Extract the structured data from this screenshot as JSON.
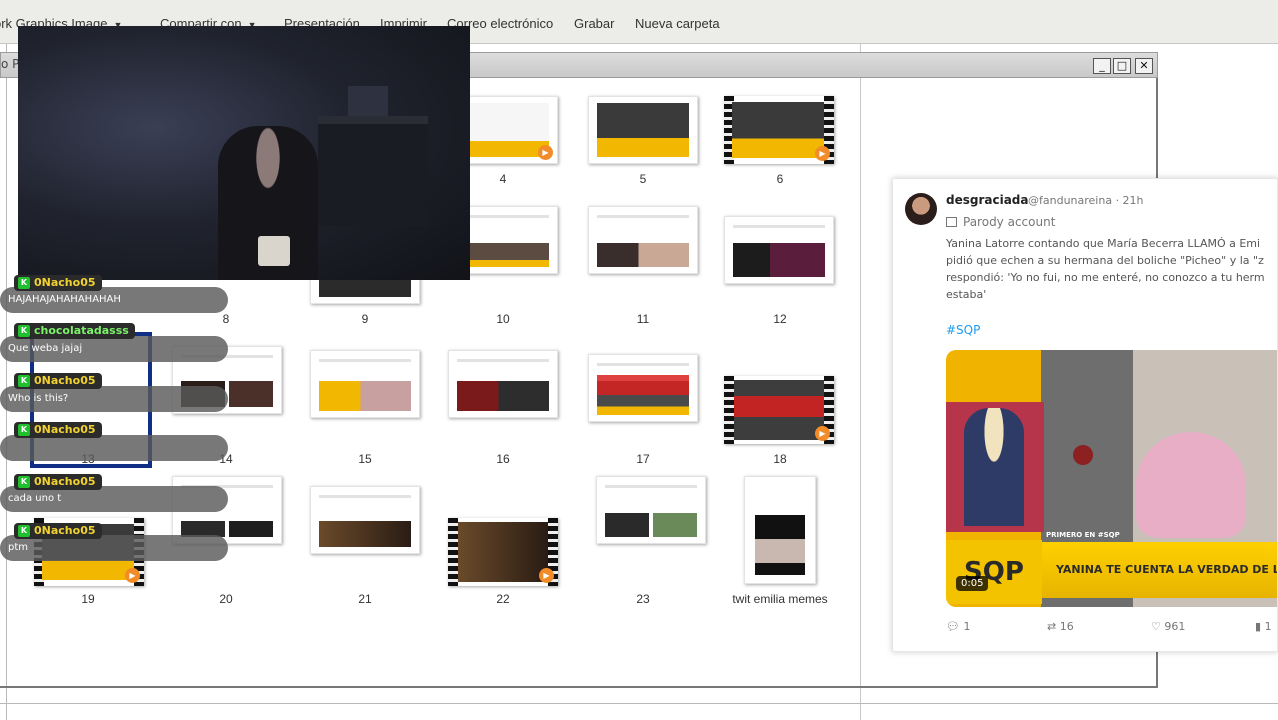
{
  "toolbar": {
    "items": [
      "ork Graphics Image",
      "Compartir con",
      "Presentación",
      "Imprimir",
      "Correo electrónico",
      "Grabar",
      "Nueva carpeta"
    ]
  },
  "inner_window": {
    "title_fragment": "o P"
  },
  "thumbnails": [
    {
      "label": "4"
    },
    {
      "label": "5"
    },
    {
      "label": "6"
    },
    {
      "label": "8"
    },
    {
      "label": "9"
    },
    {
      "label": "10"
    },
    {
      "label": "11"
    },
    {
      "label": "12"
    },
    {
      "label": "13"
    },
    {
      "label": "14"
    },
    {
      "label": "15"
    },
    {
      "label": "16"
    },
    {
      "label": "17"
    },
    {
      "label": "18"
    },
    {
      "label": "19"
    },
    {
      "label": "20"
    },
    {
      "label": "21"
    },
    {
      "label": "22"
    },
    {
      "label": "23"
    },
    {
      "label": "twit emilia memes"
    }
  ],
  "tweet": {
    "name": "desgraciada",
    "handle": "@fandunareina · 21h",
    "account_type": "Parody account",
    "text_lines": [
      "Yanina Latorre contando que María Becerra LLAMÓ a Emi",
      "pidió que echen a su hermana del boliche \"Picheo\" y la \"z",
      "respondió: 'Yo no fui, no me enteré, no conozco a tu herm",
      "estaba'"
    ],
    "hashtag": "#SQP",
    "media": {
      "logo": "SQP",
      "kicker": "PRIMERO EN #SQP",
      "headline": "YANINA TE CUENTA LA VERDAD DE LA PELEA",
      "duration": "0:05"
    },
    "replies": "1",
    "retweets": "16",
    "likes": "961",
    "views": "1"
  },
  "chat": [
    {
      "user": "0Nacho05",
      "message": "HAJAHAJAHAHAHAHAH",
      "color": "yellow"
    },
    {
      "user": "chocolatadasss",
      "message": "Que weba jajaj",
      "color": "green"
    },
    {
      "user": "0Nacho05",
      "message": "Who is this?",
      "color": "yellow"
    },
    {
      "user": "0Nacho05",
      "message": "",
      "color": "yellow"
    },
    {
      "user": "0Nacho05",
      "message": "cada uno t",
      "color": "yellow"
    },
    {
      "user": "0Nacho05",
      "message": "ptm",
      "color": "yellow"
    }
  ],
  "colors": {
    "accent_yellow": "#f4c300",
    "twitter_blue": "#1d9bf0",
    "chat_badge_green": "#1fbf2d"
  }
}
